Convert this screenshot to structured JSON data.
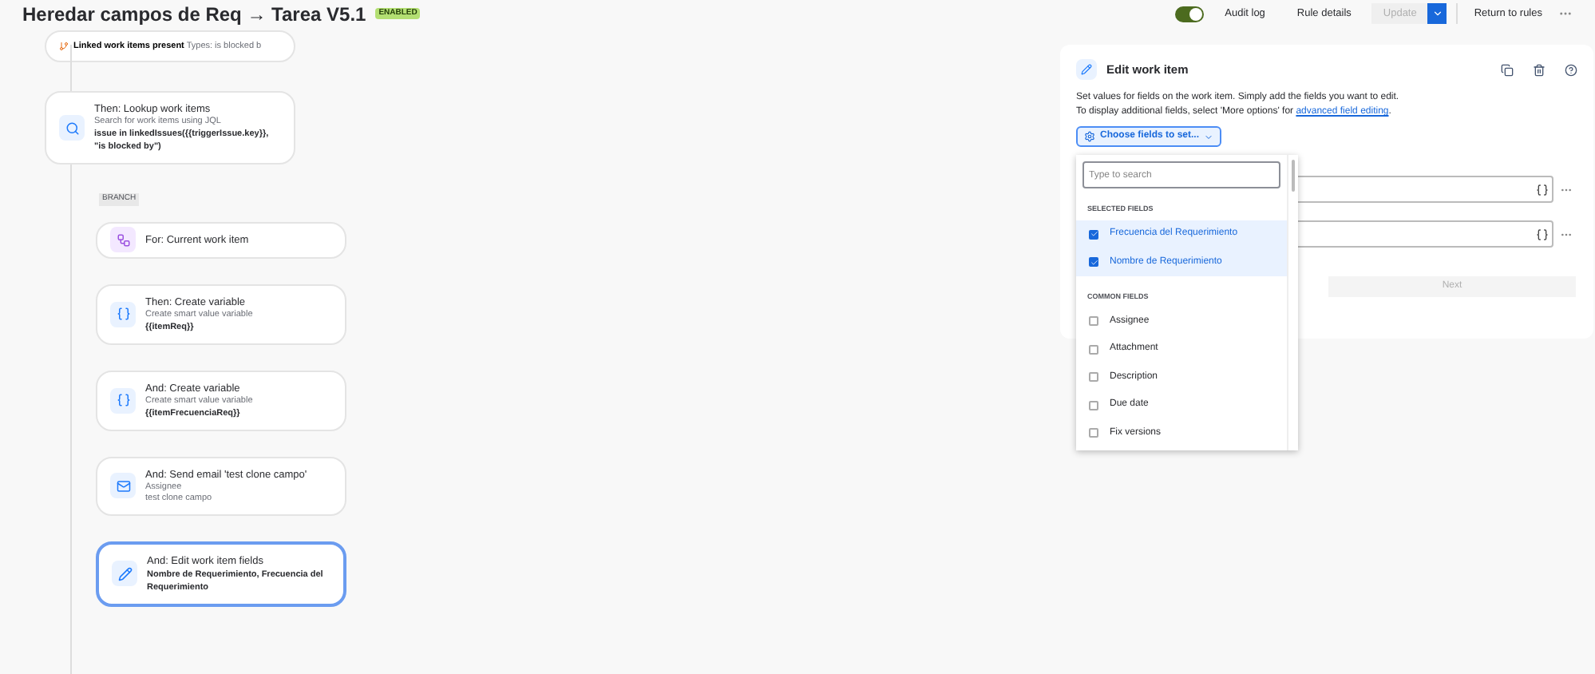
{
  "header": {
    "title": "Heredar campos de Req → Tarea V5.1",
    "status_badge": "ENABLED",
    "enabled_toggle": {
      "on": true
    },
    "buttons": [
      {
        "label": "Audit log",
        "disabled": false
      },
      {
        "label": "Rule details",
        "disabled": false
      },
      {
        "label": "Update",
        "disabled": true
      }
    ],
    "return_button": "Return to rules"
  },
  "flow": {
    "condition": {
      "label": "Linked work items present",
      "detail": "Types: is blocked b"
    },
    "lookup": {
      "title": "Then: Lookup work items",
      "description": "Search for work items using JQL",
      "detail": "issue in linkedIssues({{triggerIssue.key}}, \"is blocked by\")"
    },
    "branch_label": "BRANCH",
    "steps": [
      {
        "kind": "for",
        "title": "For: Current work item",
        "selected": false
      },
      {
        "kind": "variable",
        "title": "Then: Create variable",
        "description": "Create smart value variable",
        "detail": "{{itemReq}}",
        "selected": false
      },
      {
        "kind": "variable",
        "title": "And: Create variable",
        "description": "Create smart value variable",
        "detail": "{{itemFrecuenciaReq}}",
        "selected": false
      },
      {
        "kind": "email",
        "title": "And: Send email 'test clone campo'",
        "description": "Assignee",
        "description_2": "test clone campo",
        "selected": false
      },
      {
        "kind": "edit",
        "title": "And: Edit work item fields",
        "detail": "Nombre de Requerimiento, Frecuencia del Requerimiento",
        "selected": true
      }
    ]
  },
  "panel": {
    "title": "Edit work item",
    "description": "Set values for fields on the work item. Simply add the fields you want to edit.",
    "description_2": "To display additional fields, select 'More options' for ",
    "link": "advanced field editing",
    "link_suffix": ".",
    "choose_button": "Choose fields to set...",
    "next_button": {
      "label": "Next",
      "disabled": true
    }
  },
  "dropdown": {
    "search_placeholder": "Type to search",
    "sections": [
      {
        "heading": "SELECTED FIELDS",
        "items": [
          {
            "label": "Frecuencia del Requerimiento",
            "checked": true
          },
          {
            "label": "Nombre de Requerimiento",
            "checked": true
          }
        ]
      },
      {
        "heading": "COMMON FIELDS",
        "items": [
          {
            "label": "Assignee",
            "checked": false
          },
          {
            "label": "Attachment",
            "checked": false
          },
          {
            "label": "Description",
            "checked": false
          },
          {
            "label": "Due date",
            "checked": false
          },
          {
            "label": "Fix versions",
            "checked": false
          }
        ]
      }
    ]
  }
}
